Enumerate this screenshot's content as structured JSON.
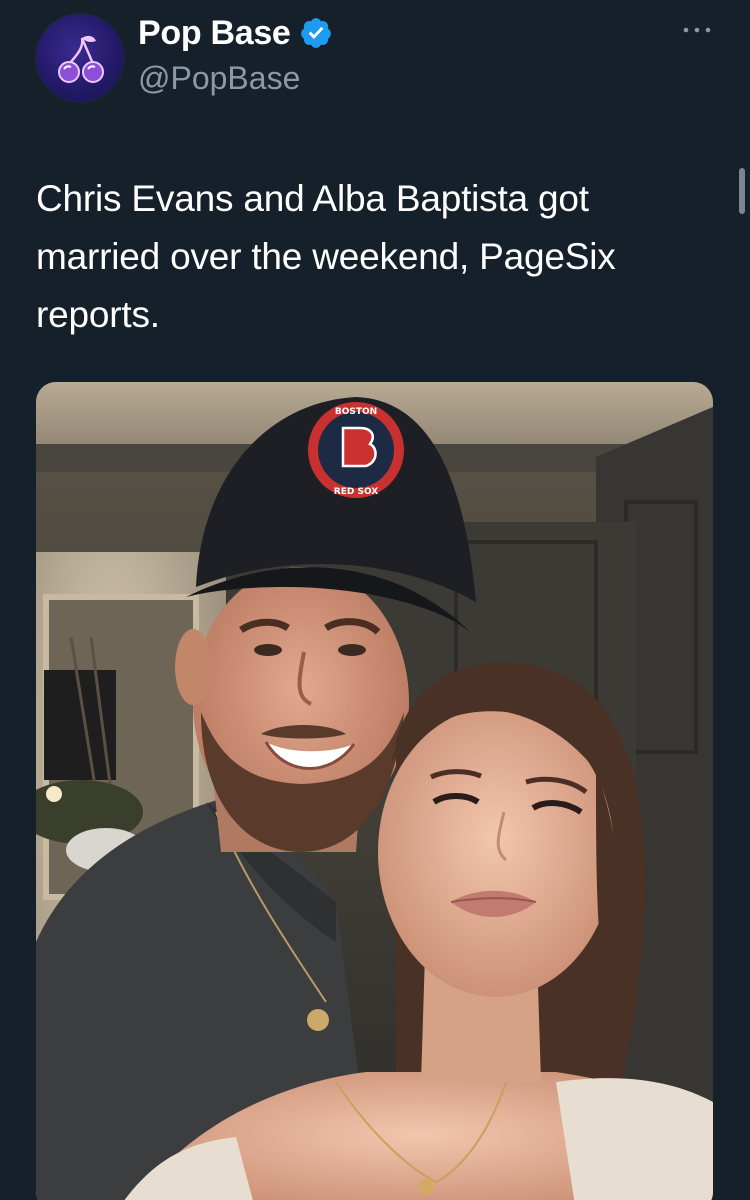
{
  "tweet": {
    "author": {
      "display_name": "Pop Base",
      "handle": "@PopBase",
      "verified": true,
      "avatar_icon": "cherries-logo-icon"
    },
    "text": "Chris Evans and Alba Baptista got married over the weekend, PageSix reports.",
    "more_icon": "ellipsis-icon",
    "media": {
      "type": "photo",
      "cap_text_top": "BOSTON",
      "cap_text_bottom": "RED SOX"
    }
  },
  "colors": {
    "background": "#15202b",
    "secondary_text": "#8b98a5",
    "verified_blue": "#1d9bf0"
  }
}
